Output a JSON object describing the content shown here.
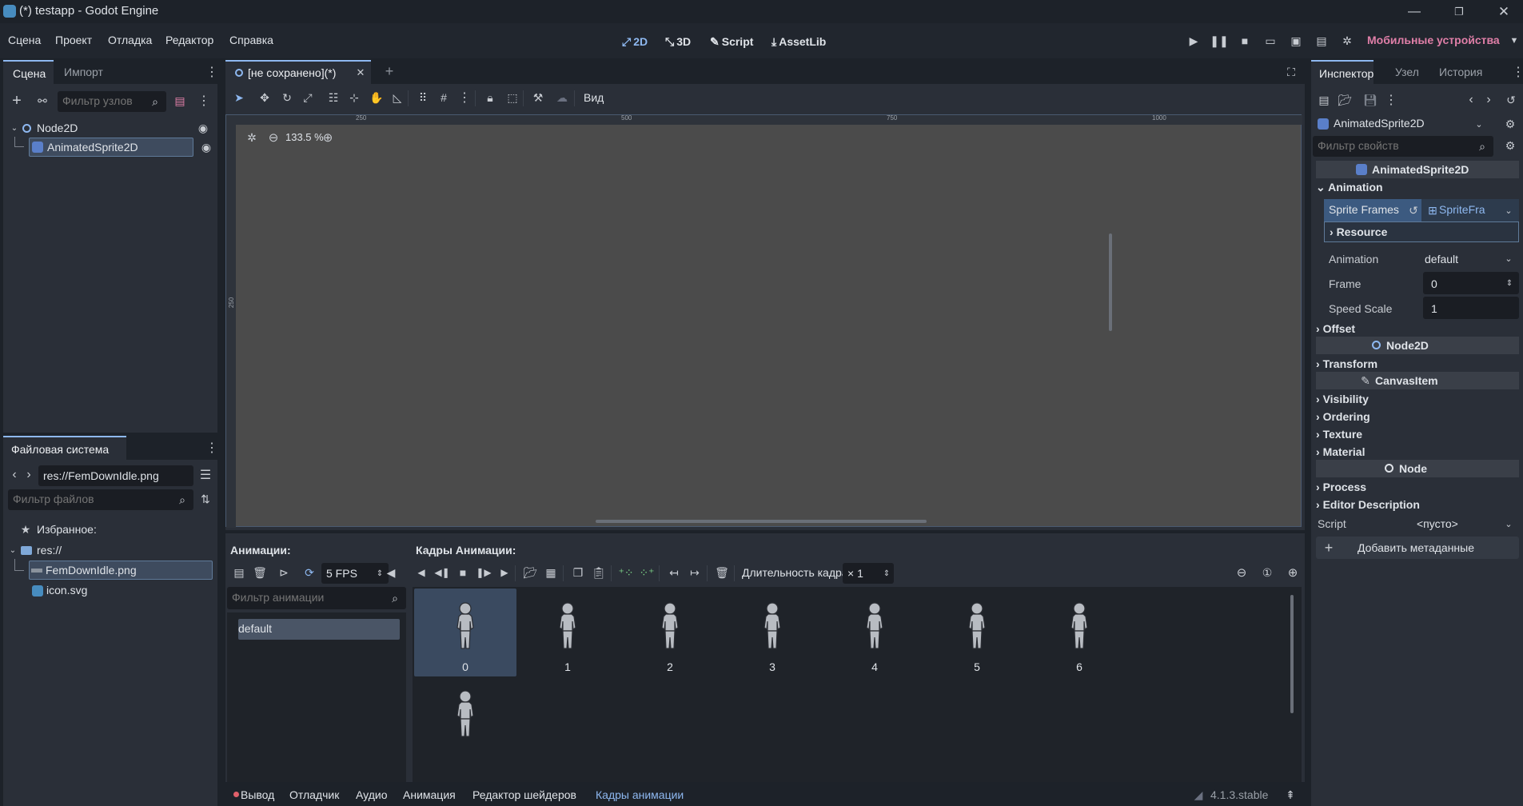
{
  "window": {
    "title": "(*) testapp - Godot Engine"
  },
  "menu": {
    "items": [
      "Сцена",
      "Проект",
      "Отладка",
      "Редактор",
      "Справка"
    ]
  },
  "workspaces": {
    "w2d": "2D",
    "w3d": "3D",
    "script": "Script",
    "assetlib": "AssetLib"
  },
  "run": {
    "device": "Мобильные устройства"
  },
  "scene_dock": {
    "tabs": [
      "Сцена",
      "Импорт"
    ],
    "filter_placeholder": "Фильтр узлов",
    "tree": [
      "Node2D",
      "AnimatedSprite2D"
    ]
  },
  "fs_dock": {
    "tab": "Файловая система",
    "path": "res://FemDownIdle.png",
    "filter_placeholder": "Фильтр файлов",
    "favorites": "Избранное:",
    "root": "res://",
    "files": [
      "FemDownIdle.png",
      "icon.svg"
    ]
  },
  "editor": {
    "scene_tab": "[не сохранено](*)",
    "view_menu": "Вид",
    "zoom": "133.5 %",
    "ruler_h": [
      "250",
      "500",
      "750",
      "1000"
    ],
    "ruler_v": [
      "250"
    ]
  },
  "sprite_frames": {
    "animations_label": "Анимации:",
    "frames_label": "Кадры Анимации:",
    "fps": "5 FPS",
    "duration_label": "Длительность кадра:",
    "duration_value": "× 1",
    "anim_filter_placeholder": "Фильтр анимации",
    "animations": [
      "default"
    ],
    "frames": [
      "0",
      "1",
      "2",
      "3",
      "4",
      "5",
      "6",
      ""
    ]
  },
  "bottom_tabs": {
    "items": [
      "Вывод",
      "Отладчик",
      "Аудио",
      "Анимация",
      "Редактор шейдеров",
      "Кадры анимации"
    ],
    "version": "4.1.3.stable"
  },
  "inspector": {
    "tabs": [
      "Инспектор",
      "Узел",
      "История"
    ],
    "object": "AnimatedSprite2D",
    "filter_placeholder": "Фильтр свойств",
    "class_header": "AnimatedSprite2D",
    "animation_section": "Animation",
    "sprite_frames_label": "Sprite Frames",
    "sprite_frames_value": "SpriteFra",
    "resource": "Resource",
    "animation_label": "Animation",
    "animation_value": "default",
    "frame_label": "Frame",
    "frame_value": "0",
    "speed_label": "Speed Scale",
    "speed_value": "1",
    "offset": "Offset",
    "node2d_header": "Node2D",
    "transform": "Transform",
    "canvasitem_header": "CanvasItem",
    "visibility": "Visibility",
    "ordering": "Ordering",
    "texture": "Texture",
    "material": "Material",
    "node_header": "Node",
    "process": "Process",
    "editor_description": "Editor Description",
    "script_label": "Script",
    "script_value": "<пусто>",
    "add_metadata": "Добавить метаданные"
  },
  "colors": {
    "accent": "#8eb8f0",
    "device": "#e07fa8",
    "selection": "#3e4b5e",
    "viewport": "#4b4b4b"
  }
}
